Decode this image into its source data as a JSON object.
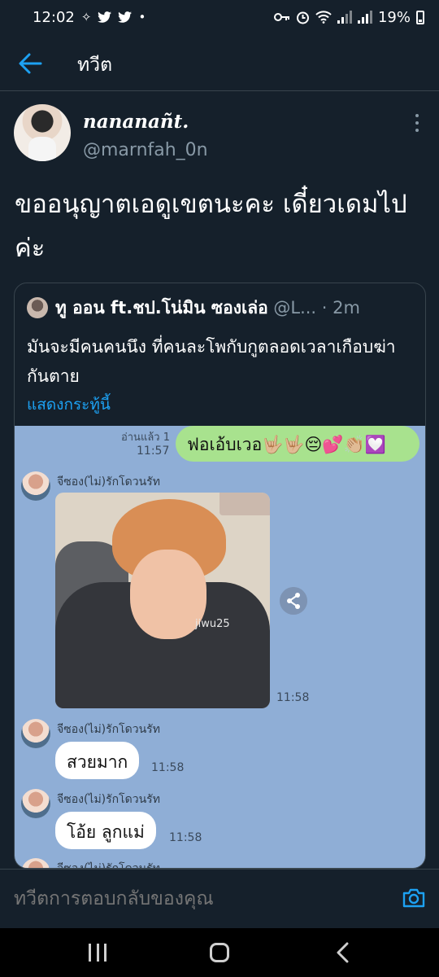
{
  "status_bar": {
    "time": "12:02",
    "battery": "19%",
    "icons": [
      "direction-icon",
      "twitter-icon",
      "twitter-icon",
      "dot-icon",
      "key-icon",
      "alarm-icon",
      "wifi-icon",
      "signal-icon",
      "signal-icon",
      "battery-icon"
    ]
  },
  "header": {
    "title": "ทวีต",
    "back_icon": "arrow-left-icon"
  },
  "tweet": {
    "display_name": "nananañt.",
    "handle": "@marnfah_0n",
    "text": "ขออนุญาตเอดูเขตนะคะ เดี๋ยวเดมไปค่ะ"
  },
  "quote": {
    "name": "ทู ออน ft.ชป.โน่มิน ซองเล่อ",
    "handle": "@L...",
    "time": "· 2m",
    "text": "มันจะมีคนคนนึง ที่คนละโพกับกูตลอดเวลาเกือบฆ่ากันตาย",
    "show_more": "แสดงกระทู้นี้",
    "chat": {
      "read_label": "อ่านแล้ว 1",
      "sent_time": "11:57",
      "sent_message": "ฟอเอ้บเวอ🤟🏼🤟🏼😔💕👏🏼💟",
      "sender": "จีซอง(ไม่)รักโดวนรัท",
      "photo_watermark": "jiwu25",
      "photo_time": "11:58",
      "messages": [
        {
          "text": "สวยมาก",
          "time": "11:58"
        },
        {
          "text": "โอ้ย ลูกแม่",
          "time": "11:58"
        }
      ]
    }
  },
  "reply": {
    "placeholder": "ทวีตการตอบกลับของคุณ"
  },
  "colors": {
    "background": "#15202b",
    "accent": "#1da1f2",
    "muted": "#8899a6"
  }
}
